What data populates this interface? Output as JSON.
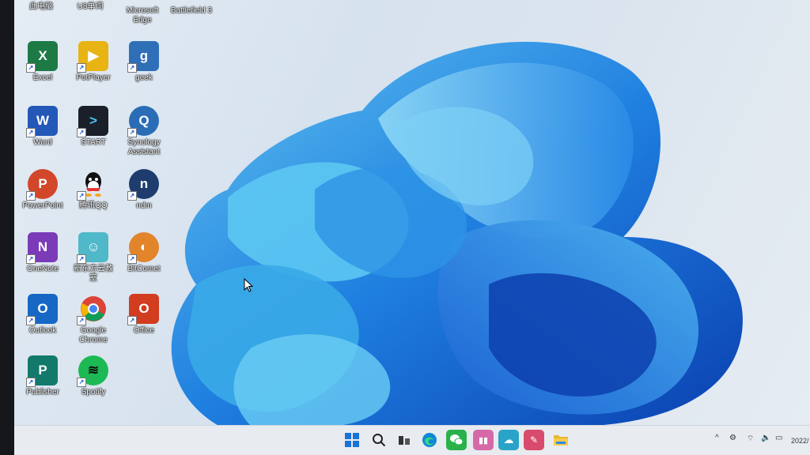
{
  "desktop": {
    "top_row_partial": [
      {
        "name": "此电脑",
        "icon": "computer-icon"
      },
      {
        "name": "U8单词",
        "icon": "app-icon"
      },
      {
        "name": "Microsoft Edge",
        "icon": "edge-icon"
      },
      {
        "name": "Battlefield 3",
        "icon": "game-icon"
      }
    ],
    "icons": [
      {
        "name": "Excel",
        "icon": "excel-icon",
        "color": "#1d7a45",
        "glyph": "X"
      },
      {
        "name": "PotPlayer",
        "icon": "potplayer-icon",
        "color": "#e8b414",
        "glyph": "▶"
      },
      {
        "name": "geek",
        "icon": "geek-icon",
        "color": "#2f6fb8",
        "glyph": "g"
      },
      {
        "name": "Word",
        "icon": "word-icon",
        "color": "#2357b8",
        "glyph": "W"
      },
      {
        "name": "START",
        "icon": "start-icon",
        "color": "#1b1f2a",
        "glyph": ">"
      },
      {
        "name": "Synology Assistant",
        "icon": "synology-icon",
        "color": "#2a6db6",
        "glyph": "Q"
      },
      {
        "name": "PowerPoint",
        "icon": "powerpoint-icon",
        "color": "#d2472a",
        "glyph": "P"
      },
      {
        "name": "腾讯QQ",
        "icon": "qq-icon",
        "color": "#222222",
        "glyph": "Q"
      },
      {
        "name": "ndm",
        "icon": "ndm-icon",
        "color": "#1e3d6e",
        "glyph": "n"
      },
      {
        "name": "OneNote",
        "icon": "onenote-icon",
        "color": "#7b3bb8",
        "glyph": "N"
      },
      {
        "name": "新东方云教室",
        "icon": "xdf-icon",
        "color": "#4fb8c9",
        "glyph": "☺"
      },
      {
        "name": "BitComet",
        "icon": "bitcomet-icon",
        "color": "#e2842a",
        "glyph": "◐"
      },
      {
        "name": "Outlook",
        "icon": "outlook-icon",
        "color": "#1668c4",
        "glyph": "O"
      },
      {
        "name": "Google Chrome",
        "icon": "chrome-icon",
        "color": "#dd4b39",
        "glyph": "◉"
      },
      {
        "name": "Office",
        "icon": "office-icon",
        "color": "#d23c1f",
        "glyph": "O"
      },
      {
        "name": "Publisher",
        "icon": "publisher-icon",
        "color": "#12796b",
        "glyph": "P"
      },
      {
        "name": "Spotify",
        "icon": "spotify-icon",
        "color": "#1db954",
        "glyph": "≋"
      }
    ]
  },
  "taskbar": {
    "apps": [
      {
        "name": "start-button",
        "icon": "windows-icon",
        "color": "#1a73d9"
      },
      {
        "name": "search-button",
        "icon": "search-icon",
        "color": "#333333"
      },
      {
        "name": "task-view-button",
        "icon": "task-view-icon",
        "color": "#333333"
      },
      {
        "name": "edge-taskbar",
        "icon": "edge-icon",
        "color": "#0f88d8"
      },
      {
        "name": "wechat-taskbar",
        "icon": "wechat-icon",
        "color": "#2bb14a"
      },
      {
        "name": "app-pink-taskbar",
        "icon": "media-icon",
        "color": "#d66aa8"
      },
      {
        "name": "app-cyan-taskbar",
        "icon": "cloud-icon",
        "color": "#2aa3c8"
      },
      {
        "name": "app-red-taskbar",
        "icon": "bookmark-icon",
        "color": "#d84b6c"
      },
      {
        "name": "file-explorer-taskbar",
        "icon": "folder-icon",
        "color": "#e9b730"
      }
    ],
    "tray": {
      "chevron": "^",
      "date_partial": "2022/"
    }
  }
}
